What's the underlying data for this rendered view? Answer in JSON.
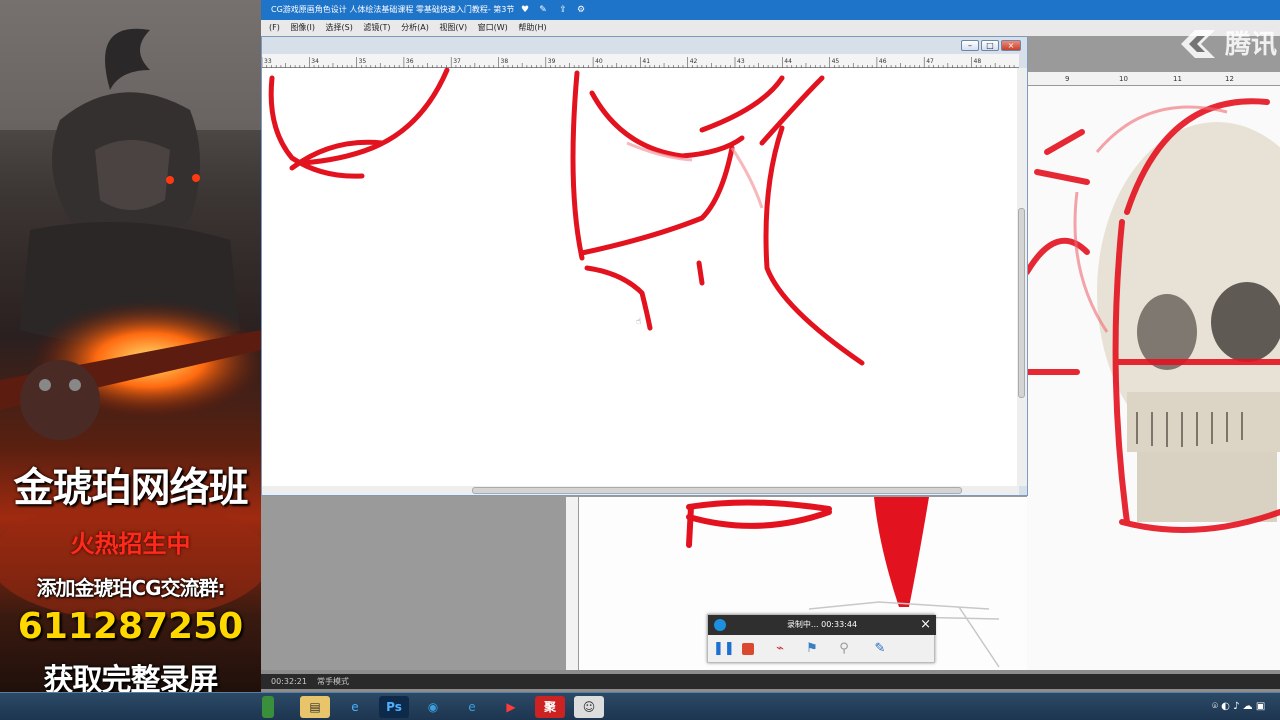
{
  "promo": {
    "title": "金琥珀网络班",
    "subtitle": "火热招生中",
    "group_line": "添加金琥珀CG交流群:",
    "group_number": "611287250",
    "record_line": "获取完整录屏"
  },
  "app": {
    "title": "CG游戏原画角色设计 人体绘法基础课程 零基础快速入门教程- 第3节",
    "menu": [
      "(F)",
      "图像(I)",
      "选择(S)",
      "滤镜(T)",
      "分析(A)",
      "视图(V)",
      "窗口(W)",
      "帮助(H)"
    ]
  },
  "ruler": {
    "top_ticks": [
      "33",
      "34",
      "35",
      "36",
      "37",
      "38",
      "39",
      "40",
      "41",
      "42",
      "43",
      "44",
      "45",
      "46",
      "47",
      "48"
    ],
    "right_ticks": [
      "9",
      "10",
      "11",
      "12"
    ]
  },
  "status": {
    "time": "00:32:21",
    "mode": "常手模式"
  },
  "recorder": {
    "label": "录制中... 00:33:44"
  },
  "watermark": {
    "text": "腾讯"
  },
  "colors": {
    "sketch_red": "#e3121f",
    "title_blue": "#1e74c9",
    "promo_yellow": "#ffd800",
    "promo_red": "#ff2a1a"
  },
  "icons": [
    "heart-icon",
    "share-icon",
    "gear-icon",
    "pause-icon",
    "stop-icon",
    "close-icon",
    "pen-icon",
    "camera-icon"
  ]
}
